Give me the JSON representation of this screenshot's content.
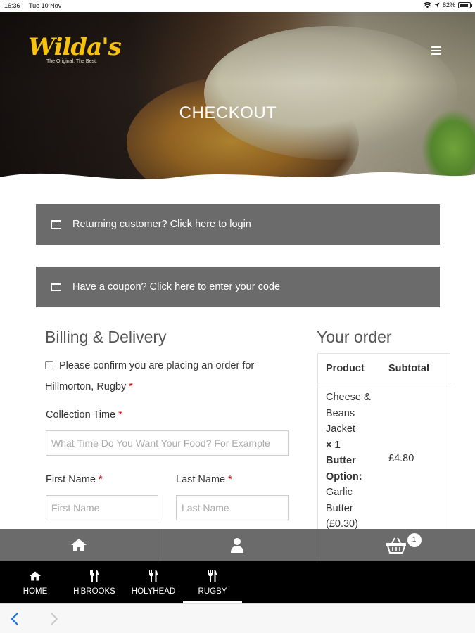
{
  "status_bar": {
    "time": "16:36",
    "date": "Tue 10 Nov",
    "battery": "82%",
    "icons": [
      "wifi-icon",
      "location-icon",
      "battery-icon"
    ]
  },
  "header": {
    "logo_text": "Wilda's",
    "logo_tagline": "The Original. The Best.",
    "title": "CHECKOUT",
    "menu_icon": "hamburger-menu-icon"
  },
  "notices": {
    "login_text": "Returning customer? Click here to login",
    "coupon_text": "Have a coupon? Click here to enter your code"
  },
  "billing": {
    "title": "Billing & Delivery",
    "confirm_text": "Please confirm you are placing an order for Hillmorton, Rugby",
    "required_mark": "*",
    "collection_label": "Collection Time",
    "collection_placeholder": "What Time Do You Want Your Food? For Example",
    "first_name_label": "First Name",
    "first_name_placeholder": "First Name",
    "last_name_label": "Last Name",
    "last_name_placeholder": "Last Name"
  },
  "order": {
    "title": "Your order",
    "col_product": "Product",
    "col_subtotal": "Subtotal",
    "item_name": "Cheese & Beans Jacket",
    "item_qty": "× 1",
    "option_label": "Butter Option:",
    "option_value": "Garlic Butter (£0.30)",
    "item_subtotal": "£4.80"
  },
  "action_bar": {
    "cart_count": "1",
    "icons": [
      "home-icon",
      "user-icon",
      "basket-icon"
    ]
  },
  "locations": [
    {
      "label": "HOME",
      "icon": "home-icon"
    },
    {
      "label": "H'BROOKS",
      "icon": "cutlery-icon"
    },
    {
      "label": "HOLYHEAD",
      "icon": "cutlery-icon"
    },
    {
      "label": "RUGBY",
      "icon": "cutlery-icon",
      "active": true
    }
  ],
  "colors": {
    "bar_gray": "#6b6b6b",
    "logo_yellow": "#f7c10d",
    "required_red": "#cc0000",
    "nav_black": "#000000"
  }
}
